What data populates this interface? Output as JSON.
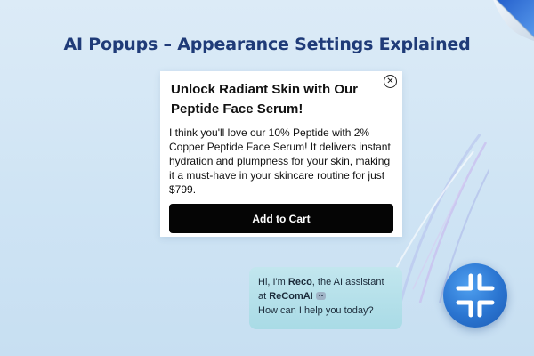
{
  "header": {
    "title": "AI Popups – Appearance Settings Explained"
  },
  "popup": {
    "title": "Unlock Radiant Skin with Our Peptide Face Serum!",
    "body": "I think you'll love our 10% Peptide with 2% Copper Peptide Face Serum! It delivers instant hydration and plumpness for your skin, making it a must-have in your skincare routine for just $799.",
    "cta_label": "Add to Cart",
    "close_icon": "close-icon"
  },
  "chat": {
    "greeting_prefix": "Hi, I'm ",
    "assistant_name": "Reco",
    "greeting_middle": ", the AI assistant at ",
    "brand_name": "ReComAI",
    "question": "How can I help you today?",
    "bot_icon": "robot-icon"
  },
  "launcher": {
    "icon": "reco-logo-icon"
  },
  "colors": {
    "title": "#1f3b78",
    "background": "#d6e8f6",
    "cta_background": "#050505",
    "chat_bubble": "#b5e0ea",
    "launcher": "#2a74d0"
  }
}
